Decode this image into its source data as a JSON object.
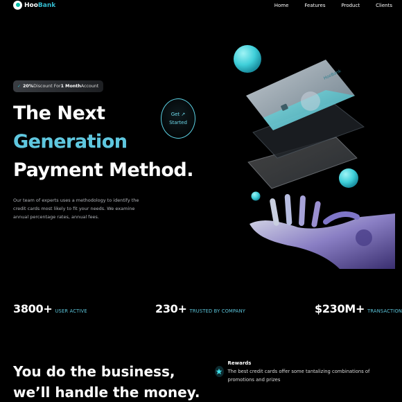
{
  "brand": {
    "name_prefix": "Hoo",
    "name_suffix": "Bank"
  },
  "nav": {
    "items": [
      "Home",
      "Features",
      "Product",
      "Clients"
    ]
  },
  "badge": {
    "percent": "20%",
    "middle": " Discount For ",
    "period": "1 Month",
    "suffix": " Account"
  },
  "hero": {
    "line1": "The Next",
    "line2": "Generation",
    "line3": "Payment Method.",
    "description": "Our team of experts uses a methodology to identify the credit cards most likely to fit your needs. We examine annual percentage rates, annual fees.",
    "cta_line1": "Get",
    "cta_arrow": "↗",
    "cta_line2": "Started"
  },
  "stats": [
    {
      "value": "3800+",
      "label": "USER ACTIVE"
    },
    {
      "value": "230+",
      "label": "TRUSTED BY COMPANY"
    },
    {
      "value": "$230M+",
      "label": "TRANSACTION"
    }
  ],
  "business": {
    "line1": "You do the business,",
    "line2": "we’ll handle the money."
  },
  "feature": {
    "title": "Rewards",
    "description": "The best credit cards offer some tantalizing combinations of promotions and prizes"
  },
  "colors": {
    "accent": "#5cc6dc",
    "background": "#000000",
    "sphere": "#4fd6e0"
  },
  "icons": [
    "logo-icon",
    "star-icon",
    "arrow-up-right-icon"
  ]
}
